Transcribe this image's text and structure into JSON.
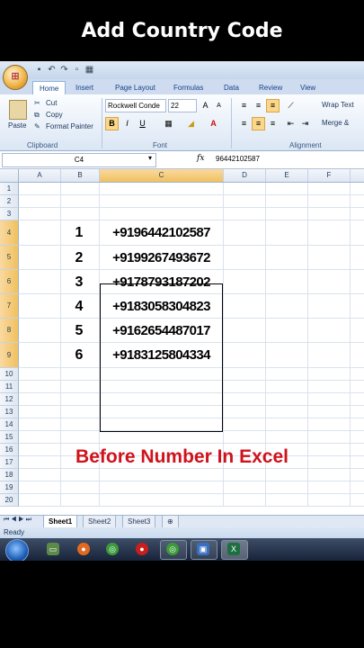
{
  "overlay": {
    "title": "Add Country Code",
    "caption": "Before Number In Excel"
  },
  "ribbon": {
    "tabs": [
      "Home",
      "Insert",
      "Page Layout",
      "Formulas",
      "Data",
      "Review",
      "View"
    ],
    "active_tab": "Home",
    "clipboard": {
      "paste": "Paste",
      "cut": "Cut",
      "copy": "Copy",
      "format_painter": "Format Painter",
      "label": "Clipboard"
    },
    "font": {
      "family": "Rockwell Conde",
      "size": "22",
      "label": "Font",
      "bold": "B",
      "italic": "I",
      "underline": "U"
    },
    "alignment": {
      "wrap_text": "Wrap Text",
      "merge": "Merge &",
      "label": "Alignment"
    }
  },
  "formula_bar": {
    "name_box": "C4",
    "fx": "fx",
    "value": "96442102587"
  },
  "grid": {
    "columns": [
      "A",
      "B",
      "C",
      "D",
      "E",
      "F"
    ],
    "selected_column": "C",
    "rows": [
      "1",
      "2",
      "3",
      "4",
      "5",
      "6",
      "7",
      "8",
      "9",
      "10",
      "11",
      "12",
      "13",
      "14",
      "15",
      "16",
      "17",
      "18",
      "19",
      "20"
    ],
    "data": [
      {
        "serial": "1",
        "phone": "+9196442102587"
      },
      {
        "serial": "2",
        "phone": "+9199267493672"
      },
      {
        "serial": "3",
        "phone": "+9178793187202"
      },
      {
        "serial": "4",
        "phone": "+9183058304823"
      },
      {
        "serial": "5",
        "phone": "+9162654487017"
      },
      {
        "serial": "6",
        "phone": "+9183125804334"
      }
    ]
  },
  "sheets": [
    "Sheet1",
    "Sheet2",
    "Sheet3"
  ],
  "active_sheet": "Sheet1",
  "status": "Ready",
  "colors": {
    "excel_green": "#1d6f42",
    "caption_red": "#d0121b",
    "selection_orange": "#f1c15f"
  }
}
